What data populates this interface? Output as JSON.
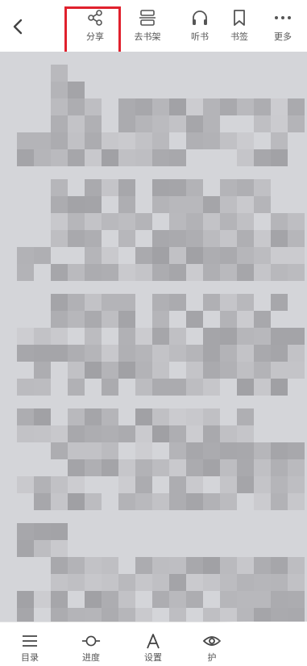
{
  "toolbar": {
    "share_label": "分享",
    "bookshelf_label": "去书架",
    "listen_label": "听书",
    "bookmark_label": "书签",
    "more_label": "更多"
  },
  "bottom": {
    "toc_label": "目录",
    "progress_label": "进度",
    "settings_label": "设置",
    "eye_label": "护"
  },
  "colors": {
    "highlight": "#e0212d",
    "page_bg": "#d4d5d9"
  },
  "icons": [
    "back-icon",
    "share-icon",
    "bookshelf-icon",
    "headphones-icon",
    "bookmark-icon",
    "more-icon",
    "menu-icon",
    "progress-icon",
    "font-icon",
    "eye-icon"
  ]
}
